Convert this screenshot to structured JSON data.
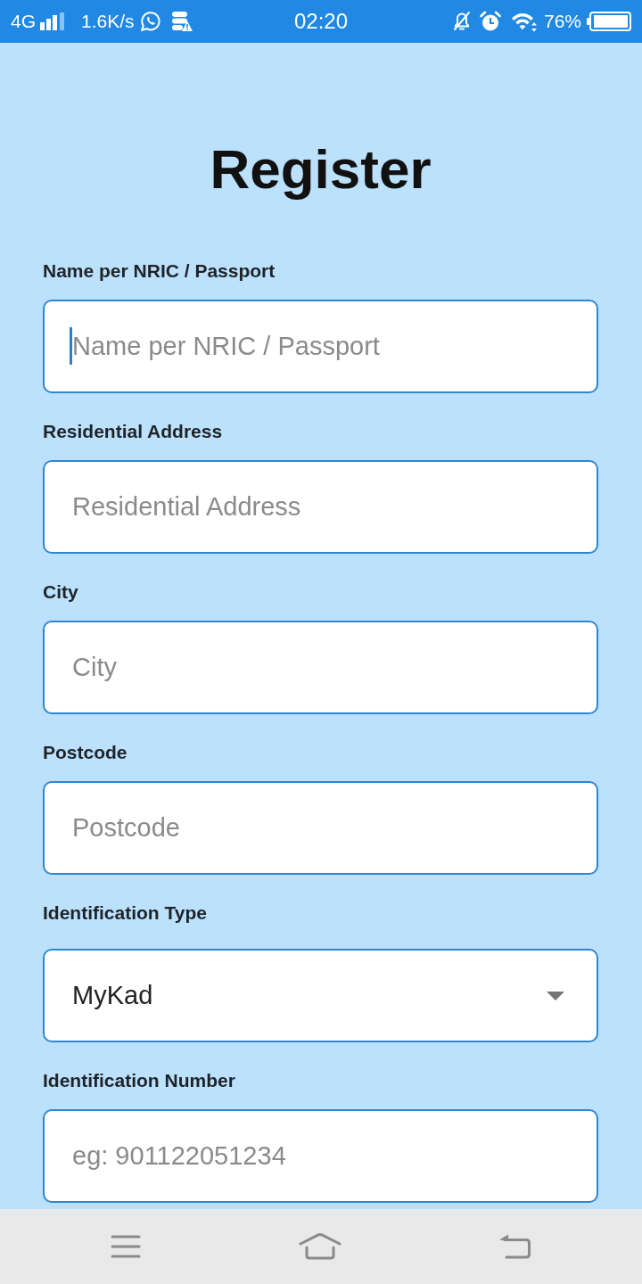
{
  "status_bar": {
    "network": "4G",
    "speed": "1.6K/s",
    "time": "02:20",
    "battery": "76%"
  },
  "title": "Register",
  "fields": [
    {
      "kind": "text",
      "label": "Name per NRIC / Passport",
      "placeholder": "Name per NRIC / Passport",
      "focused": true
    },
    {
      "kind": "text",
      "label": "Residential Address",
      "placeholder": "Residential Address",
      "focused": false
    },
    {
      "kind": "text",
      "label": "City",
      "placeholder": "City",
      "focused": false
    },
    {
      "kind": "text",
      "label": "Postcode",
      "placeholder": "Postcode",
      "focused": false
    },
    {
      "kind": "select",
      "label": "Identification Type",
      "value": "MyKad"
    },
    {
      "kind": "text",
      "label": "Identification Number",
      "placeholder": "eg: 901122051234",
      "focused": false
    }
  ]
}
